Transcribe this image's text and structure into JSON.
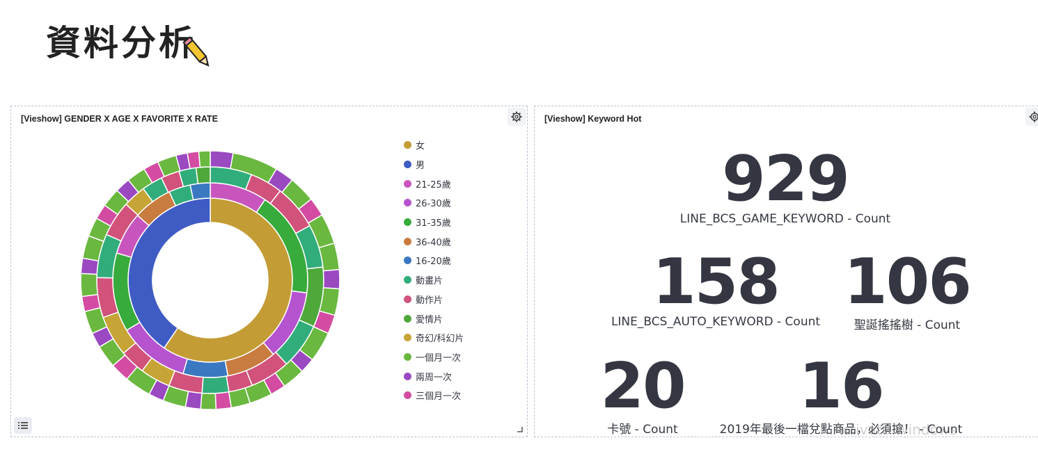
{
  "page": {
    "title": "資料分析",
    "watermark": "Activate Windows"
  },
  "panel_left": {
    "title": "[Vieshow] GENDER X AGE X FAVORITE X RATE",
    "icons": {
      "settings": "gear-icon",
      "legend_toggle": "list-icon"
    }
  },
  "panel_right": {
    "title": "[Vieshow] Keyword Hot",
    "icons": {
      "settings": "gear-icon"
    }
  },
  "chart_data": {
    "type": "sunburst",
    "legend": [
      {
        "label": "女",
        "color": "#c49c36"
      },
      {
        "label": "男",
        "color": "#3f5cc4"
      },
      {
        "label": "21-25歲",
        "color": "#c855be"
      },
      {
        "label": "26-30歲",
        "color": "#b653cf"
      },
      {
        "label": "31-35歲",
        "color": "#37ab3c"
      },
      {
        "label": "36-40歲",
        "color": "#c97c3f"
      },
      {
        "label": "16-20歲",
        "color": "#3b78c2"
      },
      {
        "label": "動畫片",
        "color": "#31ad7b"
      },
      {
        "label": "動作片",
        "color": "#d1527a"
      },
      {
        "label": "愛情片",
        "color": "#4ea83a"
      },
      {
        "label": "奇幻/科幻片",
        "color": "#c7a436"
      },
      {
        "label": "一個月一次",
        "color": "#6ab83f"
      },
      {
        "label": "兩周一次",
        "color": "#9a49c1"
      },
      {
        "label": "三個月一次",
        "color": "#d34ca2"
      }
    ],
    "rings": [
      [
        {
          "label": "女",
          "value": 59.5
        },
        {
          "label": "男",
          "value": 40.5
        }
      ],
      [
        {
          "label": "21-25歲",
          "value": 9.5
        },
        {
          "label": "31-35歲",
          "value": 17.6
        },
        {
          "label": "26-30歲",
          "value": 11.7
        },
        {
          "label": "36-40歲",
          "value": 8.3
        },
        {
          "label": "16-20歲",
          "value": 7.4
        },
        {
          "label": "26-30歲",
          "value": 11.9
        },
        {
          "label": "31-35歲",
          "value": 13.1
        },
        {
          "label": "21-25歲",
          "value": 7.1
        },
        {
          "label": "36-40歲",
          "value": 6.5
        },
        {
          "label": "動畫片",
          "value": 3.6
        },
        {
          "label": "16-20歲",
          "value": 3.3
        }
      ],
      [
        {
          "label": "動畫片",
          "value": 5.6
        },
        {
          "label": "動作片",
          "value": 4.4
        },
        {
          "label": "動作片",
          "value": 6.1
        },
        {
          "label": "動畫片",
          "value": 5.8
        },
        {
          "label": "愛情片",
          "value": 8.1
        },
        {
          "label": "動畫片",
          "value": 6.2
        },
        {
          "label": "動作片",
          "value": 5.4
        },
        {
          "label": "動作片",
          "value": 3.2
        },
        {
          "label": "動畫片",
          "value": 3.6
        },
        {
          "label": "動作片",
          "value": 4.5
        },
        {
          "label": "奇幻/科幻片",
          "value": 4.1
        },
        {
          "label": "動作片",
          "value": 3.4
        },
        {
          "label": "奇幻/科幻片",
          "value": 5.5
        },
        {
          "label": "動作片",
          "value": 5.4
        },
        {
          "label": "動畫片",
          "value": 5.9
        },
        {
          "label": "動作片",
          "value": 4.8
        },
        {
          "label": "奇幻/科幻片",
          "value": 3.1
        },
        {
          "label": "動畫片",
          "value": 2.8
        },
        {
          "label": "動作片",
          "value": 2.5
        },
        {
          "label": "動畫片",
          "value": 2.3
        },
        {
          "label": "愛情片",
          "value": 1.9
        }
      ],
      [
        {
          "label": "兩周一次",
          "value": 3.0
        },
        {
          "label": "一個月一次",
          "value": 6.0
        },
        {
          "label": "兩周一次",
          "value": 2.5
        },
        {
          "label": "一個月一次",
          "value": 3.5
        },
        {
          "label": "三個月一次",
          "value": 2.5
        },
        {
          "label": "一個月一次",
          "value": 4.0
        },
        {
          "label": "一個月一次",
          "value": 3.5
        },
        {
          "label": "兩周一次",
          "value": 2.5
        },
        {
          "label": "一個月一次",
          "value": 3.5
        },
        {
          "label": "三個月一次",
          "value": 2.5
        },
        {
          "label": "一個月一次",
          "value": 4.0
        },
        {
          "label": "兩周一次",
          "value": 2.0
        },
        {
          "label": "一個月一次",
          "value": 3.0
        },
        {
          "label": "三個月一次",
          "value": 2.0
        },
        {
          "label": "一個月一次",
          "value": 3.0
        },
        {
          "label": "一個月一次",
          "value": 2.5
        },
        {
          "label": "三個月一次",
          "value": 2.0
        },
        {
          "label": "一個月一次",
          "value": 2.0
        },
        {
          "label": "兩周一次",
          "value": 2.0
        },
        {
          "label": "一個月一次",
          "value": 3.0
        },
        {
          "label": "兩周一次",
          "value": 2.0
        },
        {
          "label": "一個月一次",
          "value": 3.5
        },
        {
          "label": "三個月一次",
          "value": 2.5
        },
        {
          "label": "一個月一次",
          "value": 3.0
        },
        {
          "label": "兩周一次",
          "value": 2.0
        },
        {
          "label": "一個月一次",
          "value": 3.0
        },
        {
          "label": "三個月一次",
          "value": 2.0
        },
        {
          "label": "一個月一次",
          "value": 3.0
        },
        {
          "label": "兩周一次",
          "value": 2.0
        },
        {
          "label": "一個月一次",
          "value": 3.0
        },
        {
          "label": "一個月一次",
          "value": 2.5
        },
        {
          "label": "三個月一次",
          "value": 2.0
        },
        {
          "label": "一個月一次",
          "value": 2.5
        },
        {
          "label": "兩周一次",
          "value": 2.0
        },
        {
          "label": "一個月一次",
          "value": 2.5
        },
        {
          "label": "三個月一次",
          "value": 2.0
        },
        {
          "label": "一個月一次",
          "value": 2.5
        },
        {
          "label": "兩周一次",
          "value": 1.5
        },
        {
          "label": "三個月一次",
          "value": 1.5
        },
        {
          "label": "一個月一次",
          "value": 1.5
        }
      ]
    ]
  },
  "metrics": [
    {
      "value": "929",
      "label": "LINE_BCS_GAME_KEYWORD - Count"
    },
    {
      "value": "158",
      "label": "LINE_BCS_AUTO_KEYWORD - Count"
    },
    {
      "value": "106",
      "label": "聖誕搖搖樹 - Count"
    },
    {
      "value": "20",
      "label": "卡號 - Count"
    },
    {
      "value": "16",
      "label": "2019年最後一檔兌點商品，必須搶！ - Count"
    }
  ]
}
